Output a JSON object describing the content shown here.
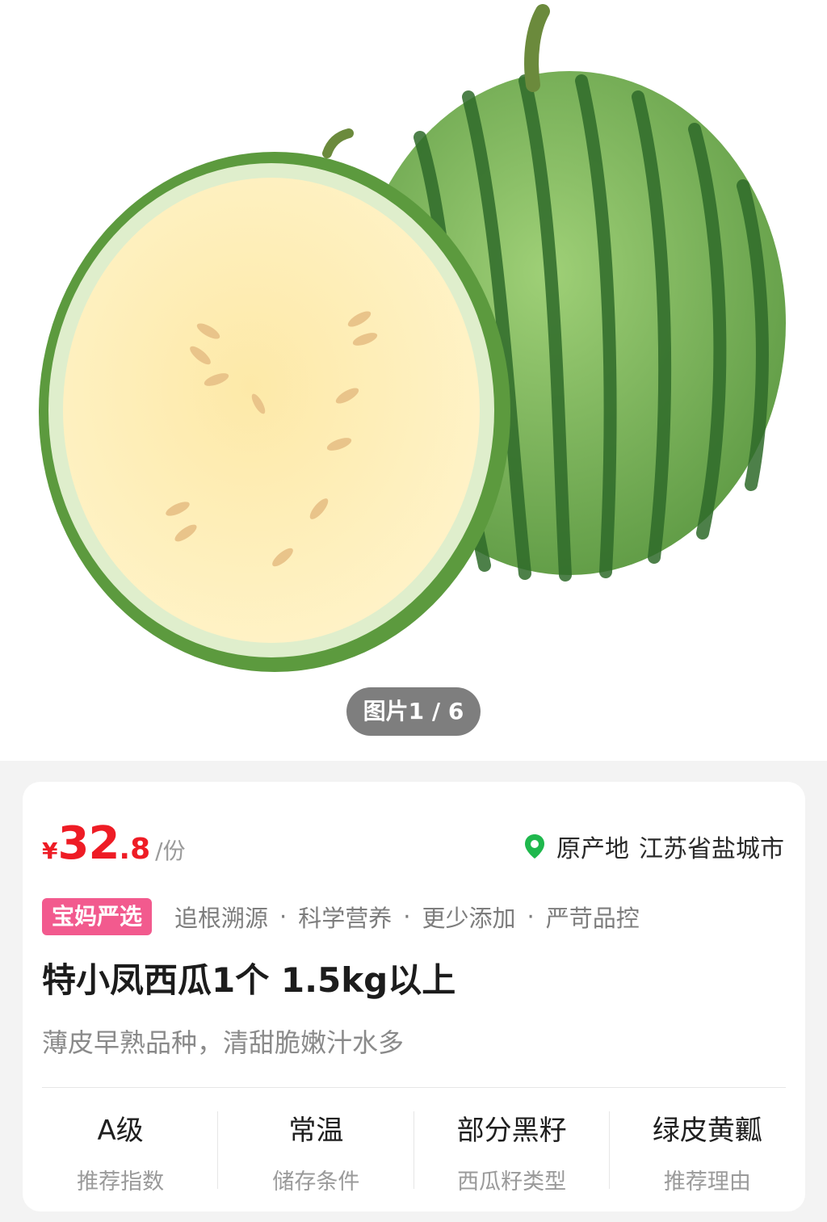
{
  "gallery": {
    "counter": "图片1 / 6"
  },
  "price": {
    "currency": "¥",
    "integer": "32",
    "decimal": ".8",
    "unit": "/份"
  },
  "origin": {
    "label": "原产地",
    "value": "江苏省盐城市",
    "icon": "location-pin-icon"
  },
  "brand": {
    "tag": "宝妈严选",
    "features": [
      "追根溯源",
      "科学营养",
      "更少添加",
      "严苛品控"
    ],
    "separator": "·"
  },
  "product": {
    "title": "特小凤西瓜1个 1.5kg以上",
    "subtitle": "薄皮早熟品种，清甜脆嫩汁水多"
  },
  "attributes": [
    {
      "value": "A级",
      "label": "推荐指数"
    },
    {
      "value": "常温",
      "label": "储存条件"
    },
    {
      "value": "部分黑籽",
      "label": "西瓜籽类型"
    },
    {
      "value": "绿皮黄瓤",
      "label": "推荐理由"
    }
  ],
  "colors": {
    "price": "#ee1c25",
    "brand_tag": "#f25a8e",
    "pin": "#1fb84d"
  }
}
